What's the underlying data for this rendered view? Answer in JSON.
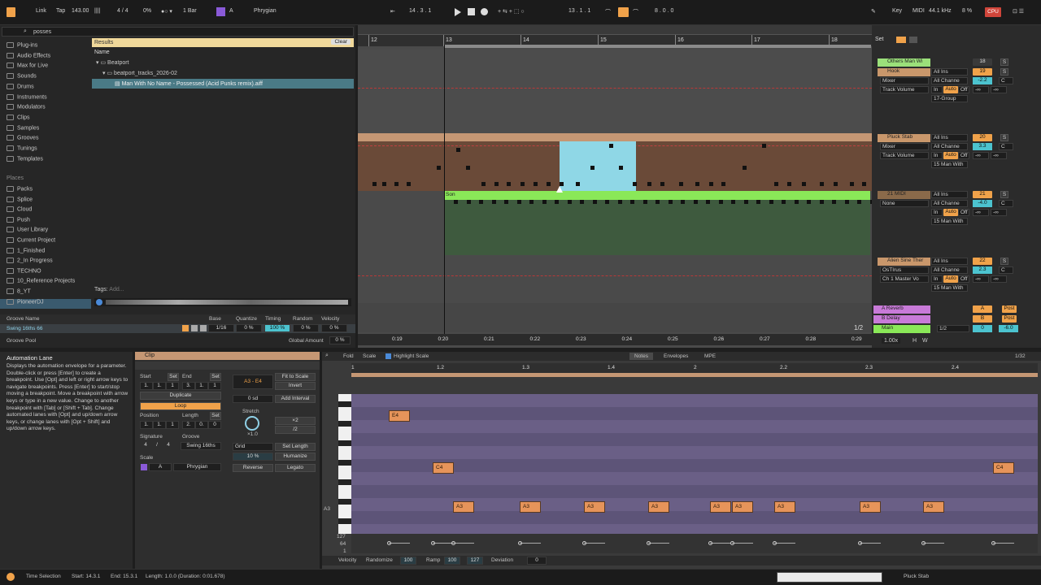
{
  "topbar": {
    "link": "Link",
    "tap": "Tap",
    "tempo": "143.00",
    "time_sig": "4 / 4",
    "zoom": "0%",
    "quantize": "1 Bar",
    "scale_root": "A",
    "scale_mode": "Phrygian",
    "position": "14 .  3 .  1",
    "loop_start": "13 .  1 .  1",
    "loop_length": "8 .  0 .  0",
    "key": "Key",
    "midi": "MIDI",
    "sample_rate": "44.1 kHz",
    "cpu_pct": "8 %",
    "cpu": "CPU"
  },
  "browser": {
    "search": "posses",
    "categories": [
      "Plug-ins",
      "Audio Effects",
      "Max for Live",
      "Sounds",
      "Drums",
      "Instruments",
      "Modulators",
      "Clips",
      "Samples",
      "Grooves",
      "Tunings",
      "Templates"
    ],
    "places_label": "Places",
    "places": [
      "Packs",
      "Splice",
      "Cloud",
      "Push",
      "User Library",
      "Current Project",
      "1_Finished",
      "2_In Progress",
      "TECHNO",
      "10_Reference Projects",
      "8_YT",
      "PioneerDJ"
    ],
    "results_label": "Results",
    "clear": "Clear",
    "name_header": "Name",
    "tree": [
      "Beatport",
      "beatport_tracks_2026-02",
      "Man With No Name - Possessed (Acid Punks remix).aiff"
    ],
    "tags_label": "Tags:",
    "tags_add": "Add..."
  },
  "groove": {
    "headers": [
      "Groove Name",
      "Base",
      "Quantize",
      "Timing",
      "Random",
      "Velocity"
    ],
    "row": {
      "name": "Swing 16ths 66",
      "base": "1/16",
      "quantize": "0 %",
      "timing": "100 %",
      "random": "0 %",
      "velocity": "0 %"
    },
    "pool_label": "Groove Pool",
    "global_amount_label": "Global Amount",
    "global_amount": "0 %"
  },
  "arrangement": {
    "bars": [
      "12",
      "13",
      "14",
      "15",
      "16",
      "17",
      "18"
    ],
    "times": [
      "0:19",
      "0:20",
      "0:21",
      "0:22",
      "0:23",
      "0:24",
      "0:25",
      "0:26",
      "0:27",
      "0:28",
      "0:29"
    ],
    "clip_name": "Son",
    "page": "1/2",
    "set_label": "Set",
    "zoom_value": "1.00x",
    "h": "H",
    "w": "W"
  },
  "mixer": {
    "tracks": [
      {
        "name": "Others Man Wi",
        "num": "18",
        "color": "#9be07a"
      },
      {
        "name": "Hook",
        "num": "19",
        "color": "#c9976b",
        "input": "All Ins",
        "channel": "All Channe",
        "device": "Mixer",
        "param": "Track Volume",
        "vol": "-2.2",
        "out": "17-Group",
        "pan": "C",
        "minf": "-∞",
        "minf2": "-∞"
      },
      {
        "name": "Pluck Stab",
        "num": "20",
        "color": "#c9976b",
        "input": "All Ins",
        "channel": "All Channe",
        "device": "Mixer",
        "param": "Track Volume",
        "vol": "3.3",
        "out": "15 Man With",
        "pan": "C",
        "minf": "-∞",
        "minf2": "-∞"
      },
      {
        "name": "21 MIDI",
        "num": "21",
        "color": "#8a6a4a",
        "input": "All Ins",
        "channel": "All Channe",
        "device": "None",
        "vol": "-4.0",
        "out": "15 Man With",
        "pan": "C",
        "minf": "-∞",
        "minf2": "-∞"
      },
      {
        "name": "Alien Sine Ther",
        "num": "22",
        "color": "#c9976b",
        "input": "All Ins",
        "channel": "All Channe",
        "device": "OsTIrus",
        "param": "Ch 1 Master Vo",
        "vol": "2.3",
        "out": "15 Man With",
        "pan": "C",
        "minf": "-∞",
        "minf2": "-∞"
      }
    ],
    "returns": [
      {
        "name": "A Reverb",
        "letter": "A",
        "post": "Post"
      },
      {
        "name": "B Delay",
        "letter": "B",
        "post": "Post"
      }
    ],
    "main": {
      "name": "Main",
      "ratio": "1/2",
      "vol": "0",
      "db": "-6.0"
    },
    "in": "In",
    "auto": "Auto",
    "off": "Off",
    "s": "S"
  },
  "info": {
    "title": "Automation Lane",
    "body": "Displays the automation envelope for a parameter. Double-click or press [Enter] to create a breakpoint. Use [Opt] and left or right arrow keys to navigate breakpoints. Press [Enter] to start/stop moving a breakpoint. Move a breakpoint with arrow keys or type in a new value. Change to another breakpoint with [Tab] or [Shift + Tab]. Change automated lanes with [Opt] and up/down arrow keys, or change lanes with [Opt + Shift] and up/down arrow keys."
  },
  "clip": {
    "title": "Clip",
    "start_label": "Start",
    "end_label": "End",
    "set": "Set",
    "start": [
      "1.",
      "1.",
      "1"
    ],
    "end": [
      "3.",
      "1.",
      "1"
    ],
    "duplicate": "Duplicate",
    "loop": "Loop",
    "position_label": "Position",
    "length_label": "Length",
    "position": [
      "1.",
      "1.",
      "1"
    ],
    "length": [
      "2.",
      "0.",
      "0"
    ],
    "signature_label": "Signature",
    "groove_label": "Groove",
    "sig": [
      "4",
      "/",
      "4"
    ],
    "groove": "Swing 16ths",
    "scale_label": "Scale",
    "scale_root": "A",
    "scale_mode": "Phrygian",
    "range": "A3 - E4",
    "fit_to_scale": "Fit to Scale",
    "invert": "Invert",
    "od": "0 sd",
    "add_interval": "Add Interval",
    "stretch": "Stretch",
    "x2": "×2",
    "half": "/2",
    "stretch_val": "×1.0",
    "grid": "Grid",
    "set_length": "Set Length",
    "pct": "10 %",
    "humanize": "Humanize",
    "reverse": "Reverse",
    "legato": "Legato"
  },
  "editor": {
    "fold": "Fold",
    "scale": "Scale",
    "highlight": "Highlight Scale",
    "tabs": [
      "Notes",
      "Envelopes",
      "MPE"
    ],
    "grid": "1/32",
    "ruler": [
      "1",
      "1.2",
      "1.3",
      "1.4",
      "2",
      "2.2",
      "2.3",
      "2.4"
    ],
    "a3": "A3",
    "notes": [
      {
        "label": "E4",
        "row": "e4",
        "x": 0.055
      },
      {
        "label": "C4",
        "row": "c4",
        "x": 0.118
      },
      {
        "label": "A3",
        "row": "a3",
        "x": 0.148
      },
      {
        "label": "A3",
        "row": "a3",
        "x": 0.245
      },
      {
        "label": "A3",
        "row": "a3",
        "x": 0.339
      },
      {
        "label": "A3",
        "row": "a3",
        "x": 0.432
      },
      {
        "label": "A3",
        "row": "a3",
        "x": 0.523
      },
      {
        "label": "A3",
        "row": "a3",
        "x": 0.554
      },
      {
        "label": "A3",
        "row": "a3",
        "x": 0.616
      },
      {
        "label": "A3",
        "row": "a3",
        "x": 0.74
      },
      {
        "label": "A3",
        "row": "a3",
        "x": 0.833
      },
      {
        "label": "C4",
        "row": "c4",
        "x": 0.935
      }
    ],
    "vel_labels": [
      "127",
      "64",
      "1"
    ],
    "velocity": "Velocity",
    "randomize": "Randomize",
    "rand_val": "100",
    "ramp": "Ramp",
    "ramp_a": "100",
    "ramp_b": "127",
    "deviation": "Deviation",
    "dev_val": "0"
  },
  "status": {
    "time_selection": "Time Selection",
    "start": "Start: 14.3.1",
    "end": "End: 15.3.1",
    "length": "Length: 1.0.0 (Duration: 0:01.678)",
    "track": "Pluck Stab"
  }
}
